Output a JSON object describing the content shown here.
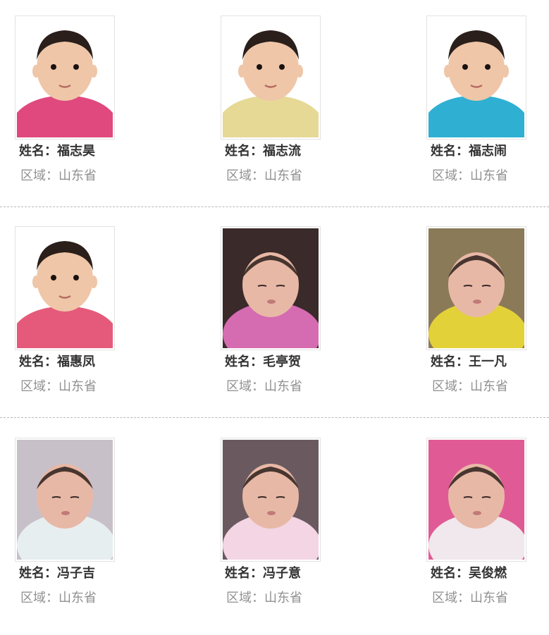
{
  "name_prefix": "姓名：",
  "region_prefix": "区域：",
  "children": [
    {
      "name": "福志昊",
      "region": "山东省",
      "photo": "child-portrait-pink-sweater",
      "bg": "#ffffff",
      "clothes": "#e0497e"
    },
    {
      "name": "福志流",
      "region": "山东省",
      "photo": "child-portrait-yellow-bunny-jacket",
      "bg": "#ffffff",
      "clothes": "#e6d996"
    },
    {
      "name": "福志闹",
      "region": "山东省",
      "photo": "child-portrait-blue-jacket",
      "bg": "#ffffff",
      "clothes": "#2fb0d3"
    },
    {
      "name": "福惠凤",
      "region": "山东省",
      "photo": "child-portrait-pink-knit-jacket",
      "bg": "#ffffff",
      "clothes": "#e55a7b"
    },
    {
      "name": "毛亭贺",
      "region": "山东省",
      "photo": "newborn-pink-blanket-held",
      "bg": "#3a2a2a",
      "clothes": "#d56bb0"
    },
    {
      "name": "王一凡",
      "region": "山东省",
      "photo": "infant-yellow-floral-outfit",
      "bg": "#8a7a58",
      "clothes": "#e3d13a"
    },
    {
      "name": "冯子吉",
      "region": "山东省",
      "photo": "newborn-sleeping-white-outfit",
      "bg": "#c8c0c8",
      "clothes": "#e7eef0"
    },
    {
      "name": "冯子意",
      "region": "山东省",
      "photo": "newborn-pink-bib",
      "bg": "#6a5a60",
      "clothes": "#f3d5e3"
    },
    {
      "name": "吴俊燃",
      "region": "山东省",
      "photo": "infant-pink-floral-blanket",
      "bg": "#e05a95",
      "clothes": "#f0e8ec"
    }
  ]
}
